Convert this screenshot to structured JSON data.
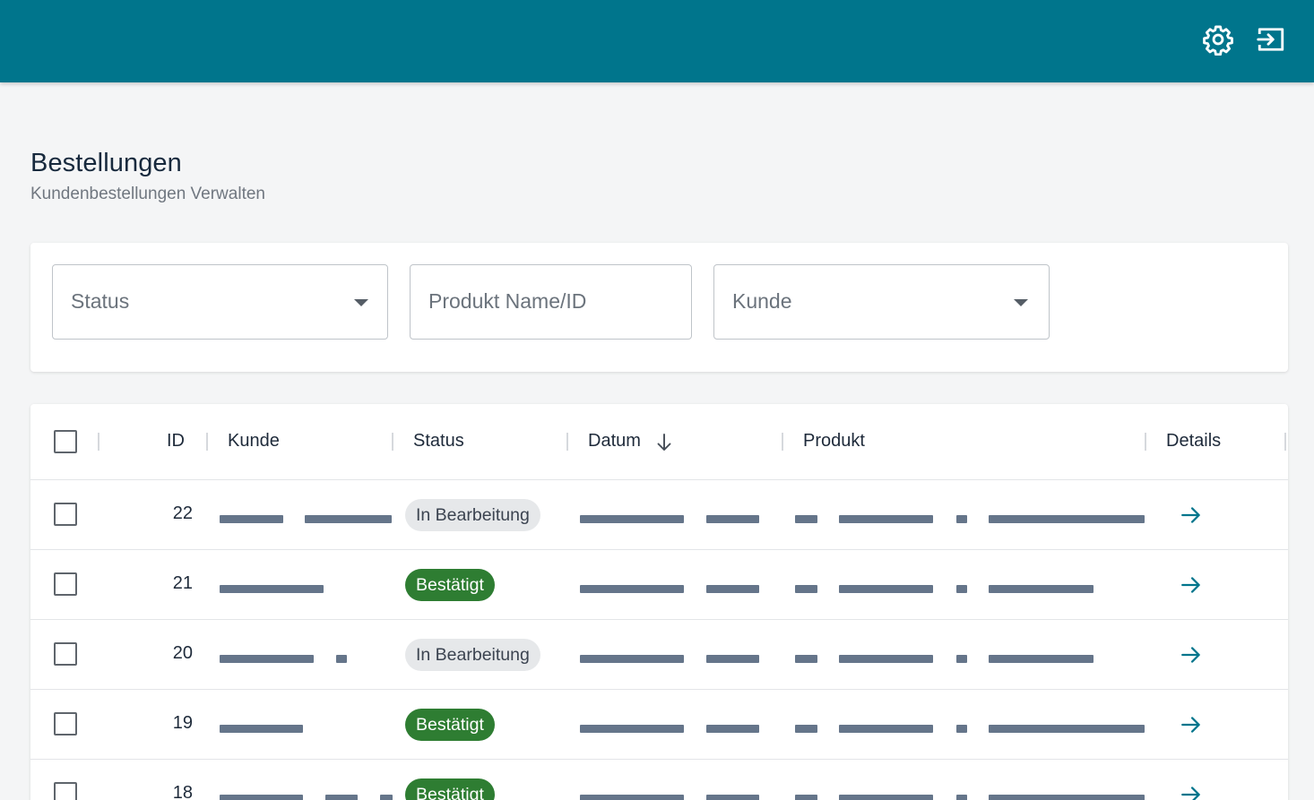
{
  "header": {
    "settings_icon": "gear-icon",
    "logout_icon": "logout-icon",
    "bg_color": "#00758c"
  },
  "page": {
    "title": "Bestellungen",
    "subtitle": "Kundenbestellungen Verwalten"
  },
  "filters": {
    "status_placeholder": "Status",
    "product_placeholder": "Produkt Name/ID",
    "customer_placeholder": "Kunde"
  },
  "table": {
    "columns": {
      "id": "ID",
      "customer": "Kunde",
      "status": "Status",
      "date": "Datum",
      "product": "Produkt",
      "details": "Details"
    },
    "sort": {
      "column": "Datum",
      "direction": "descending"
    },
    "rows": [
      {
        "id": "22",
        "status": "In Bearbeitung",
        "status_kind": "processing"
      },
      {
        "id": "21",
        "status": "Bestätigt",
        "status_kind": "confirmed"
      },
      {
        "id": "20",
        "status": "In Bearbeitung",
        "status_kind": "processing"
      },
      {
        "id": "19",
        "status": "Bestätigt",
        "status_kind": "confirmed"
      },
      {
        "id": "18",
        "status": "Bestätigt",
        "status_kind": "confirmed"
      }
    ]
  },
  "colors": {
    "accent": "#00758c",
    "confirmed": "#2e7d32",
    "processing": "#e6e8ea",
    "redacted": "#65758a"
  }
}
